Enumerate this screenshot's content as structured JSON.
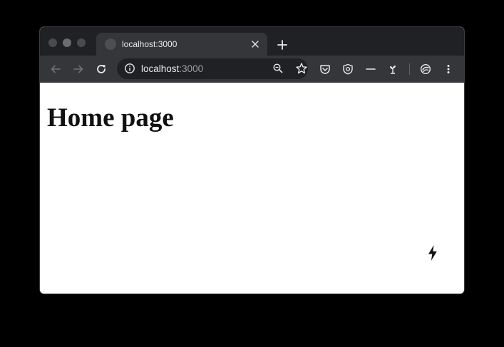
{
  "browser": {
    "tab": {
      "title": "localhost:3000"
    },
    "address_bar": {
      "host": "localhost",
      "port": ":3000"
    },
    "icons": {
      "back": "arrow-left-icon",
      "forward": "arrow-right-icon",
      "reload": "reload-icon",
      "site_info": "info-icon",
      "zoom": "zoom-icon",
      "bookmark": "star-icon",
      "extensions": [
        "pocket-icon",
        "shield-icon",
        "dash-icon",
        "plant-icon",
        "devtools-icon"
      ],
      "menu": "kebab-menu-icon"
    },
    "colors": {
      "frame": "#202124",
      "toolbar": "#35363a",
      "omnibox": "#202124",
      "text": "#e8eaed",
      "muted_text": "#9aa0a6"
    }
  },
  "page": {
    "heading": "Home page",
    "indicator_icon": "lightning-icon",
    "background": "#ffffff"
  }
}
